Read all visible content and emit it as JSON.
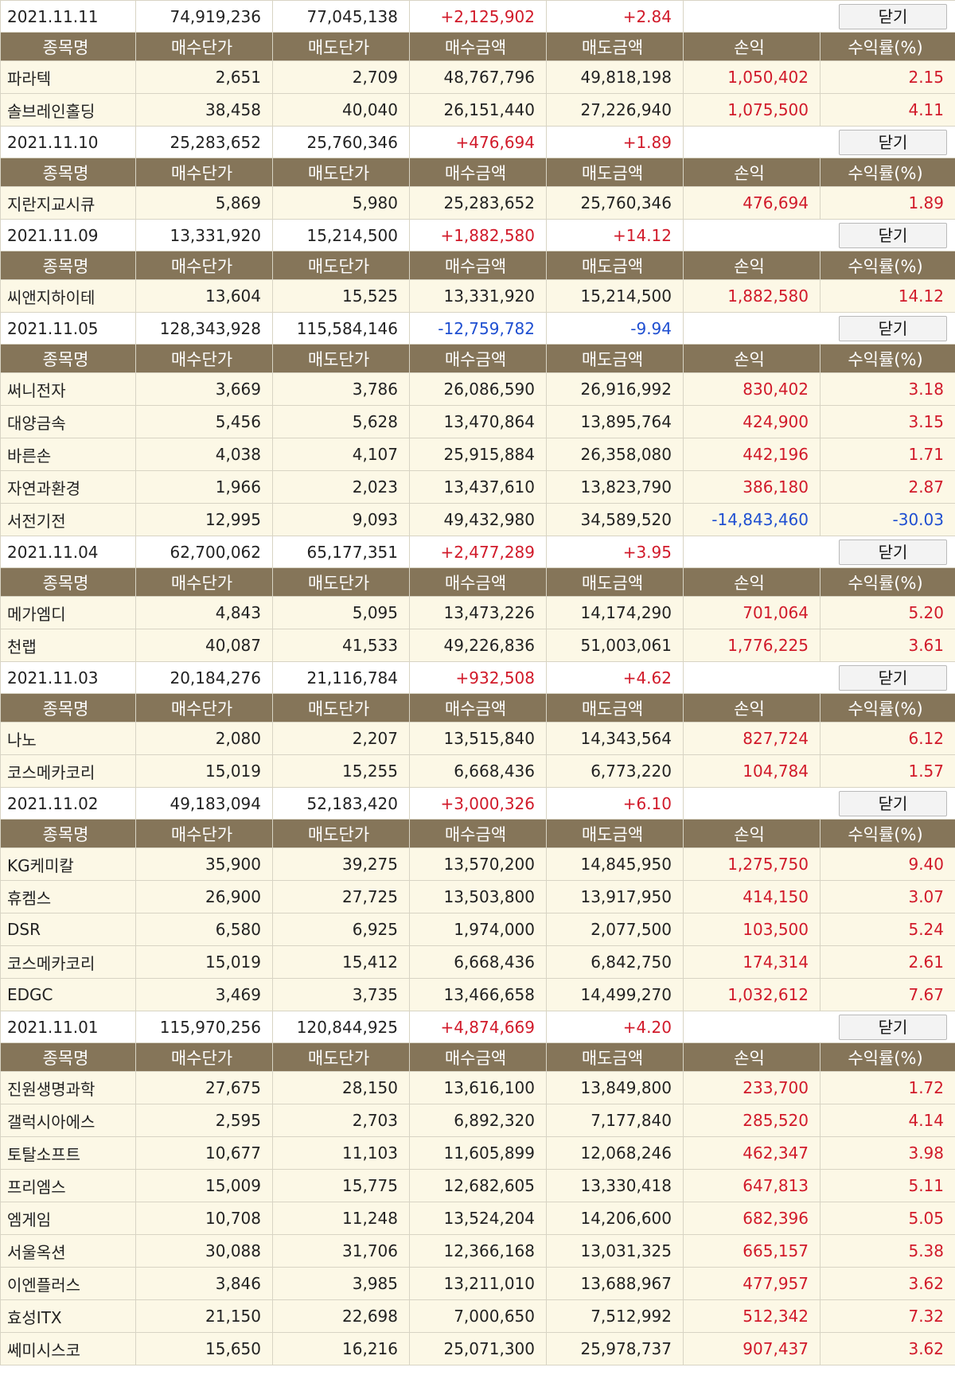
{
  "headers": [
    "종목명",
    "매수단가",
    "매도단가",
    "매수금액",
    "매도금액",
    "손익",
    "수익률(%)"
  ],
  "close_label": "닫기",
  "groups": [
    {
      "date": "2021.11.11",
      "buy_total": "74,919,236",
      "sell_total": "77,045,138",
      "profit": "+2,125,902",
      "rate": "+2.84",
      "rows": [
        [
          "파라텍",
          "2,651",
          "2,709",
          "48,767,796",
          "49,818,198",
          "1,050,402",
          "2.15"
        ],
        [
          "솔브레인홀딩",
          "38,458",
          "40,040",
          "26,151,440",
          "27,226,940",
          "1,075,500",
          "4.11"
        ]
      ]
    },
    {
      "date": "2021.11.10",
      "buy_total": "25,283,652",
      "sell_total": "25,760,346",
      "profit": "+476,694",
      "rate": "+1.89",
      "rows": [
        [
          "지란지교시큐",
          "5,869",
          "5,980",
          "25,283,652",
          "25,760,346",
          "476,694",
          "1.89"
        ]
      ]
    },
    {
      "date": "2021.11.09",
      "buy_total": "13,331,920",
      "sell_total": "15,214,500",
      "profit": "+1,882,580",
      "rate": "+14.12",
      "rows": [
        [
          "씨앤지하이테",
          "13,604",
          "15,525",
          "13,331,920",
          "15,214,500",
          "1,882,580",
          "14.12"
        ]
      ]
    },
    {
      "date": "2021.11.05",
      "buy_total": "128,343,928",
      "sell_total": "115,584,146",
      "profit": "-12,759,782",
      "rate": "-9.94",
      "rows": [
        [
          "써니전자",
          "3,669",
          "3,786",
          "26,086,590",
          "26,916,992",
          "830,402",
          "3.18"
        ],
        [
          "대양금속",
          "5,456",
          "5,628",
          "13,470,864",
          "13,895,764",
          "424,900",
          "3.15"
        ],
        [
          "바른손",
          "4,038",
          "4,107",
          "25,915,884",
          "26,358,080",
          "442,196",
          "1.71"
        ],
        [
          "자연과환경",
          "1,966",
          "2,023",
          "13,437,610",
          "13,823,790",
          "386,180",
          "2.87"
        ],
        [
          "서전기전",
          "12,995",
          "9,093",
          "49,432,980",
          "34,589,520",
          "-14,843,460",
          "-30.03"
        ]
      ]
    },
    {
      "date": "2021.11.04",
      "buy_total": "62,700,062",
      "sell_total": "65,177,351",
      "profit": "+2,477,289",
      "rate": "+3.95",
      "rows": [
        [
          "메가엠디",
          "4,843",
          "5,095",
          "13,473,226",
          "14,174,290",
          "701,064",
          "5.20"
        ],
        [
          "천랩",
          "40,087",
          "41,533",
          "49,226,836",
          "51,003,061",
          "1,776,225",
          "3.61"
        ]
      ]
    },
    {
      "date": "2021.11.03",
      "buy_total": "20,184,276",
      "sell_total": "21,116,784",
      "profit": "+932,508",
      "rate": "+4.62",
      "rows": [
        [
          "나노",
          "2,080",
          "2,207",
          "13,515,840",
          "14,343,564",
          "827,724",
          "6.12"
        ],
        [
          "코스메카코리",
          "15,019",
          "15,255",
          "6,668,436",
          "6,773,220",
          "104,784",
          "1.57"
        ]
      ]
    },
    {
      "date": "2021.11.02",
      "buy_total": "49,183,094",
      "sell_total": "52,183,420",
      "profit": "+3,000,326",
      "rate": "+6.10",
      "rows": [
        [
          "KG케미칼",
          "35,900",
          "39,275",
          "13,570,200",
          "14,845,950",
          "1,275,750",
          "9.40"
        ],
        [
          "휴켐스",
          "26,900",
          "27,725",
          "13,503,800",
          "13,917,950",
          "414,150",
          "3.07"
        ],
        [
          "DSR",
          "6,580",
          "6,925",
          "1,974,000",
          "2,077,500",
          "103,500",
          "5.24"
        ],
        [
          "코스메카코리",
          "15,019",
          "15,412",
          "6,668,436",
          "6,842,750",
          "174,314",
          "2.61"
        ],
        [
          "EDGC",
          "3,469",
          "3,735",
          "13,466,658",
          "14,499,270",
          "1,032,612",
          "7.67"
        ]
      ]
    },
    {
      "date": "2021.11.01",
      "buy_total": "115,970,256",
      "sell_total": "120,844,925",
      "profit": "+4,874,669",
      "rate": "+4.20",
      "rows": [
        [
          "진원생명과학",
          "27,675",
          "28,150",
          "13,616,100",
          "13,849,800",
          "233,700",
          "1.72"
        ],
        [
          "갤럭시아에스",
          "2,595",
          "2,703",
          "6,892,320",
          "7,177,840",
          "285,520",
          "4.14"
        ],
        [
          "토탈소프트",
          "10,677",
          "11,103",
          "11,605,899",
          "12,068,246",
          "462,347",
          "3.98"
        ],
        [
          "프리엠스",
          "15,009",
          "15,775",
          "12,682,605",
          "13,330,418",
          "647,813",
          "5.11"
        ],
        [
          "엠게임",
          "10,708",
          "11,248",
          "13,524,204",
          "14,206,600",
          "682,396",
          "5.05"
        ],
        [
          "서울옥션",
          "30,088",
          "31,706",
          "12,366,168",
          "13,031,325",
          "665,157",
          "5.38"
        ],
        [
          "이엔플러스",
          "3,846",
          "3,985",
          "13,211,010",
          "13,688,967",
          "477,957",
          "3.62"
        ],
        [
          "효성ITX",
          "21,150",
          "22,698",
          "7,000,650",
          "7,512,992",
          "512,342",
          "7.32"
        ],
        [
          "쎄미시스코",
          "15,650",
          "16,216",
          "25,071,300",
          "25,978,737",
          "907,437",
          "3.62"
        ]
      ]
    }
  ],
  "colors": {
    "header_bg": "#857559",
    "row_bg": "#fcf8e6",
    "positive": "#d11a2a",
    "negative": "#1f4fd1"
  }
}
